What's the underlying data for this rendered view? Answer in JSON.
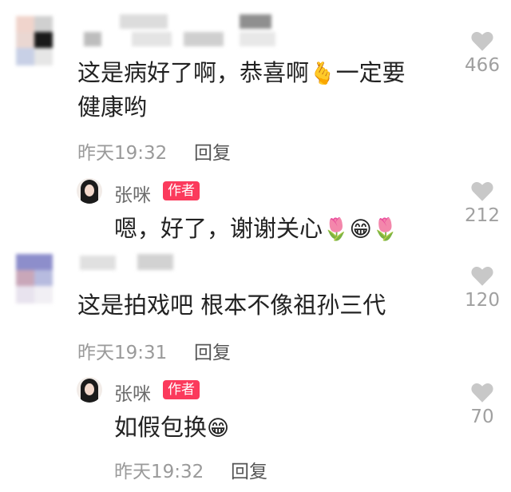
{
  "comments": [
    {
      "text_line1": "这是病好了啊，恭喜啊",
      "emoji1": "🫰",
      "text_line1b": "一定要",
      "text_line2": "健康哟",
      "time": "昨天19:32",
      "reply": "回复",
      "likes": "466"
    },
    {
      "text": "这是拍戏吧 根本不像祖孙三代",
      "time": "昨天19:31",
      "reply": "回复",
      "likes": "120"
    }
  ],
  "replies": [
    {
      "author": "张咪",
      "badge": "作者",
      "text": "嗯，好了，谢谢关心",
      "emojis": [
        "🌷",
        "😁",
        "🌷"
      ],
      "likes": "212"
    },
    {
      "author": "张咪",
      "badge": "作者",
      "text": "如假包换",
      "emojis": [
        "😁"
      ],
      "time": "昨天19:32",
      "reply": "回复",
      "likes": "70"
    }
  ],
  "colors": {
    "badge": "#fb3a5c",
    "heart": "#c8c8c8",
    "meta": "#9a9a9a"
  },
  "icons": {
    "like": "heart-icon"
  }
}
